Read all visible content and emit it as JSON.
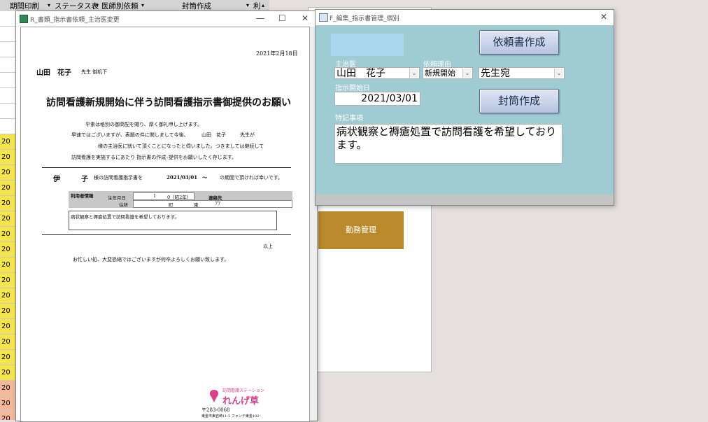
{
  "background": {
    "header": {
      "col1": "期間印刷",
      "col2": "ステータス表",
      "col3": "医師別依頼",
      "col4": "封筒作成",
      "col5": "利"
    },
    "left_strip": [
      "20",
      "20",
      "20",
      "20",
      "20",
      "20",
      "20",
      "20",
      "20",
      "20",
      "20",
      "20",
      "20",
      "20",
      "20",
      "20",
      "20",
      "20",
      "20"
    ],
    "kinmu_button": "勤務管理"
  },
  "report_window": {
    "title": "R_書類_指示書依頼_主治医変更",
    "minimize": "—",
    "maximize": "☐",
    "close": "✕",
    "date": "2021年2月18日",
    "doctor_name": "山田　花子",
    "honorific": "先生 御机下",
    "heading": "訪問看護新規開始に伴う訪問看護指示書御提供のお願い",
    "body_line1": "平素は格別の御高配を賜り、厚く御礼申し上げます。",
    "body_line2a": "早速ではございますが、表題の件に関しまして今後、",
    "body_line2_name": "山田　花子",
    "body_line2b": "先生が",
    "body_line3": "様の主治医に就いて頂くことになったと伺いました。つきましては継続して",
    "body_line4": "訪問看護を実施するにあたり 指示書の作成･提供をお願いしたく存じます。",
    "patient_initial_1": "伊",
    "patient_initial_2": "子",
    "request_text": "様の訪問看護指示書を",
    "start_date": "2021/03/01　～",
    "request_tail": "の期間で頂ければ幸いです。",
    "table": {
      "section_label": "利用者情報",
      "birth_label": "生年月日",
      "birth_value_a": "1",
      "birth_value_b": "0（昭2年）",
      "contact_label": "連絡先",
      "address_label": "住所",
      "address_v1": "町",
      "address_v2": "東",
      "address_v3": "77"
    },
    "remarks": "病状観察と褥瘡処置で訪問看護を希望しております。",
    "closing": "以上",
    "footer_line": "お忙しい処、大変恐縮ではございますが何卒よろしくお願い致します。",
    "logo_small": "訪問看護ステーション",
    "logo_main": "れんげ草",
    "postal": "〒283-0068",
    "address": "東金市東岩崎11-5 フォンテ東金102"
  },
  "edit_window": {
    "title": "F_編集_指示書管理_個別",
    "close": "✕",
    "request_btn": "依頼書作成",
    "envelope_btn": "封筒作成",
    "doctor_label": "主治医",
    "doctor_value": "山田　花子",
    "reason_label": "依頼理由",
    "reason_value": "新規開始",
    "addressee_value": "先生宛",
    "start_label": "指示開始日",
    "start_value": "2021/03/01",
    "notes_label": "特記事項",
    "notes_value": "病状観察と褥瘡処置で訪問看護を希望しております。",
    "dropdown_arrow": "⌄"
  }
}
